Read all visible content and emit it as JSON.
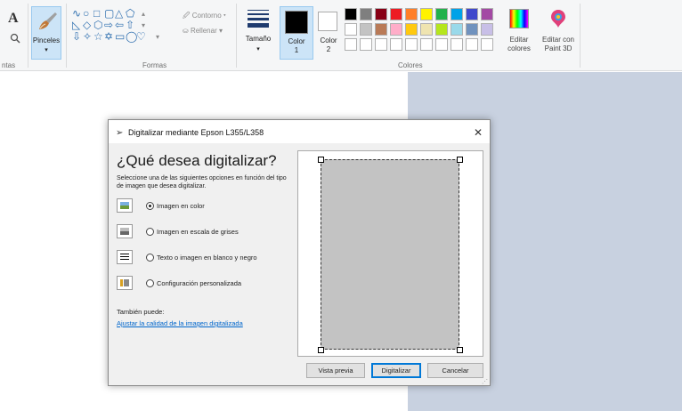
{
  "ribbon": {
    "tools_label": "ntas",
    "brushes_label": "Pinceles",
    "shapes_label": "Formas",
    "outline_label": "Contorno",
    "fill_label": "Rellenar",
    "size_label": "Tamaño",
    "color1_label_line1": "Color",
    "color1_label_line2": "1",
    "color2_label_line1": "Color",
    "color2_label_line2": "2",
    "colors_label": "Colores",
    "edit_colors_line1": "Editar",
    "edit_colors_line2": "colores",
    "paint3d_line1": "Editar con",
    "paint3d_line2": "Paint 3D",
    "dropdown_arrow": "▾",
    "palette_row1": [
      "#000000",
      "#7f7f7f",
      "#880015",
      "#ed1c24",
      "#ff7f27",
      "#fff200",
      "#22b14c",
      "#00a2e8",
      "#3f48cc",
      "#a349a4"
    ],
    "palette_row2": [
      "#ffffff",
      "#c3c3c3",
      "#b97a57",
      "#ffaec9",
      "#ffc90e",
      "#efe4b0",
      "#b5e61d",
      "#99d9ea",
      "#7092be",
      "#c8bfe7"
    ],
    "palette_row3": [
      "#ffffff",
      "#ffffff",
      "#ffffff",
      "#ffffff",
      "#ffffff",
      "#ffffff",
      "#ffffff",
      "#ffffff",
      "#ffffff",
      "#ffffff"
    ]
  },
  "dialog": {
    "title": "Digitalizar mediante Epson L355/L358",
    "close": "✕",
    "heading": "¿Qué desea digitalizar?",
    "instructions": "Seleccione una de las siguientes opciones en función del tipo de imagen que desea digitalizar.",
    "options": [
      {
        "label": "Imagen en color",
        "selected": true
      },
      {
        "label": "Imagen en escala de grises",
        "selected": false
      },
      {
        "label": "Texto o imagen en blanco y negro",
        "selected": false
      },
      {
        "label": "Configuración personalizada",
        "selected": false
      }
    ],
    "also_label": "También puede:",
    "adjust_link": "Ajustar la calidad de la imagen digitalizada",
    "buttons": {
      "preview": "Vista previa",
      "scan": "Digitalizar",
      "cancel": "Cancelar"
    }
  }
}
